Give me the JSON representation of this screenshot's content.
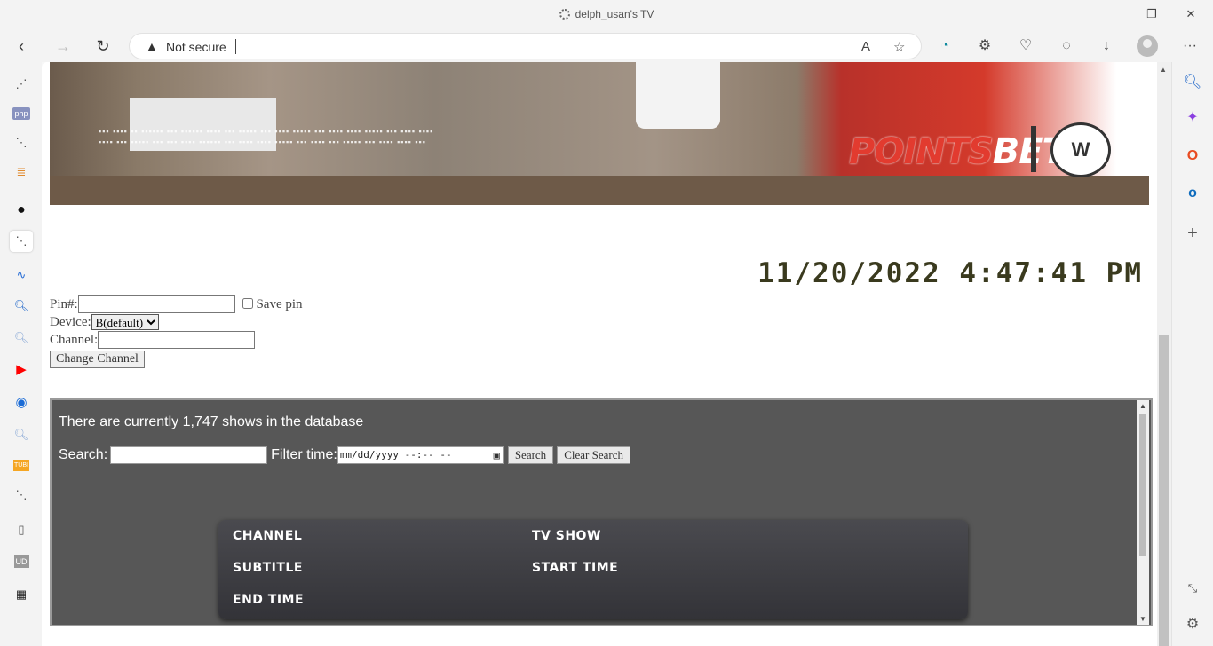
{
  "browser": {
    "tab_title": "delph_usan's TV",
    "security_label": "Not secure",
    "window_controls": [
      "minimize-icon",
      "close-icon"
    ],
    "nav_icons": [
      "back-icon",
      "forward-icon",
      "refresh-icon"
    ],
    "toolbar_icons": [
      "read-aloud-icon",
      "favorite-add-icon",
      "edge-shopping-icon",
      "extensions-icon",
      "sync-icon",
      "split-screen-icon",
      "downloads-icon",
      "profile-icon",
      "more-icon"
    ]
  },
  "left_sidebar": {
    "items": [
      "grid-icon",
      "php-icon",
      "page-icon",
      "bookmark-icon",
      "github-icon",
      "page-icon",
      "chart-icon",
      "search-icon",
      "search-icon",
      "youtube-icon",
      "browser-icon",
      "search-icon",
      "tubi-icon",
      "page-icon",
      "file-icon",
      "id-icon",
      "qr-icon"
    ],
    "php_label": "php",
    "tubi_label": "TUBI",
    "id_label": "UD"
  },
  "right_sidebar": {
    "items": [
      "search-icon",
      "copilot-icon",
      "office-icon",
      "outlook-icon",
      "add-icon",
      "screenshot-icon",
      "settings-icon"
    ]
  },
  "banner": {
    "brand_red": "POINTS",
    "brand_white": "BET",
    "crest_text": "W"
  },
  "clock": {
    "datetime": "11/20/2022 4:47:41 PM"
  },
  "form": {
    "pin_label": "Pin#:",
    "save_pin_label": "Save pin",
    "device_label": "Device:",
    "device_selected": "B(default)",
    "channel_label": "Channel:",
    "change_channel_button": "Change Channel"
  },
  "shows": {
    "count_text": "There are currently 1,747 shows in the database",
    "search_label": "Search:",
    "filter_label": "Filter time:",
    "date_placeholder": "mm/dd/yyyy --:-- --",
    "search_button": "Search",
    "clear_button": "Clear Search",
    "columns": [
      "CHANNEL",
      "TV SHOW",
      "SUBTITLE",
      "START TIME",
      "END TIME"
    ]
  },
  "colors": {
    "panel_bg": "#575757",
    "clock_text": "#3a3a1e",
    "brand_red": "#e23b2f"
  }
}
